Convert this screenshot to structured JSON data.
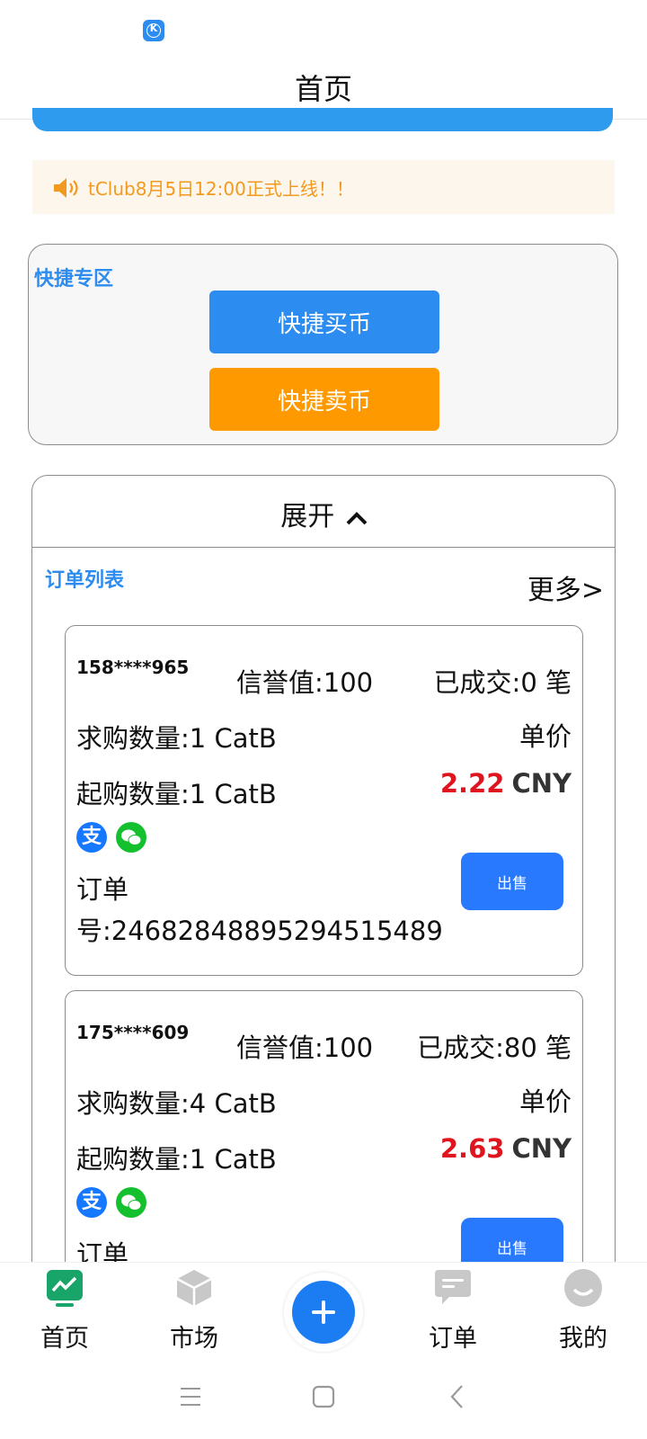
{
  "status": {
    "app_badge_letter": "K"
  },
  "header": {
    "title": "首页"
  },
  "notice": {
    "text": "tClub8月5日12:00正式上线！！"
  },
  "quick_zone": {
    "title": "快捷专区",
    "buy_label": "快捷买币",
    "sell_label": "快捷卖币"
  },
  "panel": {
    "expand_label": "展开",
    "list_title": "订单列表",
    "more_label": "更多>"
  },
  "orders": [
    {
      "user": "158****965",
      "credit": "信誉值:100",
      "deals": "已成交:0 笔",
      "buy_qty": "求购数量:1 CatB",
      "price_label": "单价",
      "min_qty": "起购数量:1 CatB",
      "price": "2.22",
      "currency": "CNY",
      "order_label": "订单",
      "order_no": "号:2468284889529451548​9",
      "action_label": "出售"
    },
    {
      "user": "175****609",
      "credit": "信誉值:100",
      "deals": "已成交:80 笔",
      "buy_qty": "求购数量:4 CatB",
      "price_label": "单价",
      "min_qty": "起购数量:1 CatB",
      "price": "2.63",
      "currency": "CNY",
      "order_label": "订单",
      "order_no": "",
      "action_label": "出售"
    }
  ],
  "bottom_nav": {
    "home": "首页",
    "market": "市场",
    "orders": "订单",
    "mine": "我的"
  },
  "colors": {
    "primary_blue": "#2d8cf0",
    "orange": "#ff9900",
    "price_red": "#e0141e",
    "active_green": "#19a56a"
  },
  "icons": {
    "notice": "speaker-icon",
    "pay_1": "alipay-icon",
    "pay_2": "wechat-pay-icon",
    "expand": "chevron-up-icon"
  }
}
